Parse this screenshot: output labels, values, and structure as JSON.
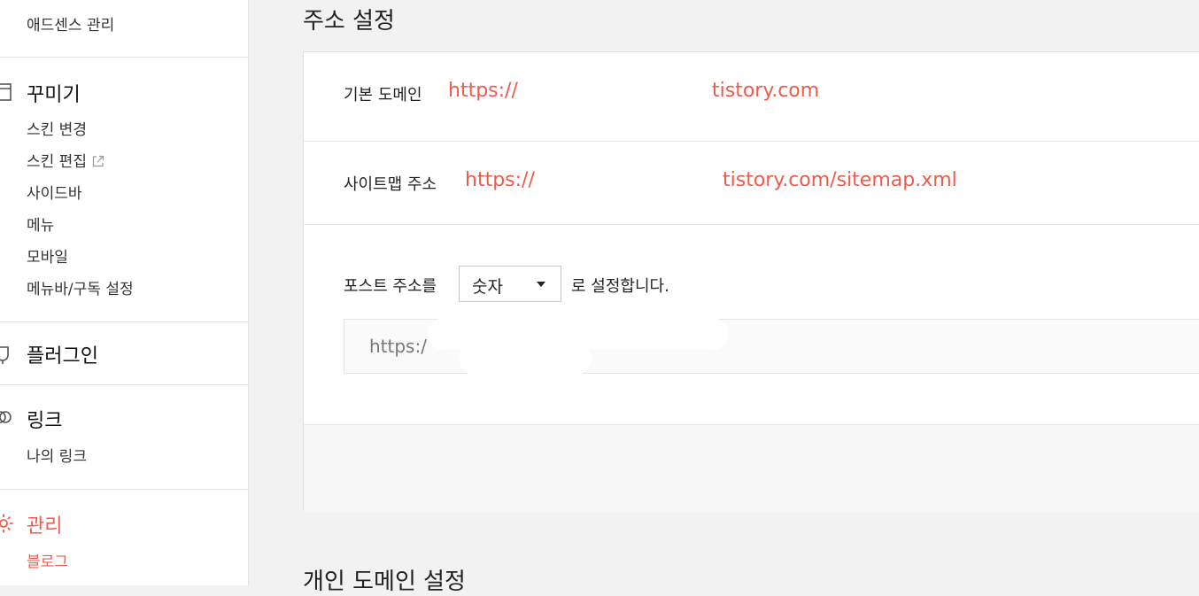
{
  "sidebar": {
    "top_item": "애드센스 관리",
    "decorate": {
      "title": "꾸미기",
      "icon": "layout-icon",
      "items": [
        "스킨 변경",
        "스킨 편집",
        "사이드바",
        "메뉴",
        "모바일",
        "메뉴바/구독 설정"
      ]
    },
    "plugin": {
      "title": "플러그인",
      "icon": "plug-icon"
    },
    "link": {
      "title": "링크",
      "icon": "link-icon",
      "items": [
        "나의 링크"
      ]
    },
    "manage": {
      "title": "관리",
      "icon": "gear-icon",
      "items": [
        "블로그"
      ]
    }
  },
  "main": {
    "section_title": "주소 설정",
    "default_domain": {
      "label": "기본 도메인",
      "value_prefix": "https://",
      "value_suffix": "tistory.com"
    },
    "sitemap": {
      "label": "사이트맵 주소",
      "value_prefix": "https://",
      "value_suffix": "tistory.com/sitemap.xml"
    },
    "post_address": {
      "label": "포스트 주소를",
      "selected": "숫자",
      "suffix": "로 설정합니다.",
      "preview": "https:/"
    },
    "next_section_title": "개인 도메인 설정"
  },
  "colors": {
    "accent": "#f05a4b"
  }
}
